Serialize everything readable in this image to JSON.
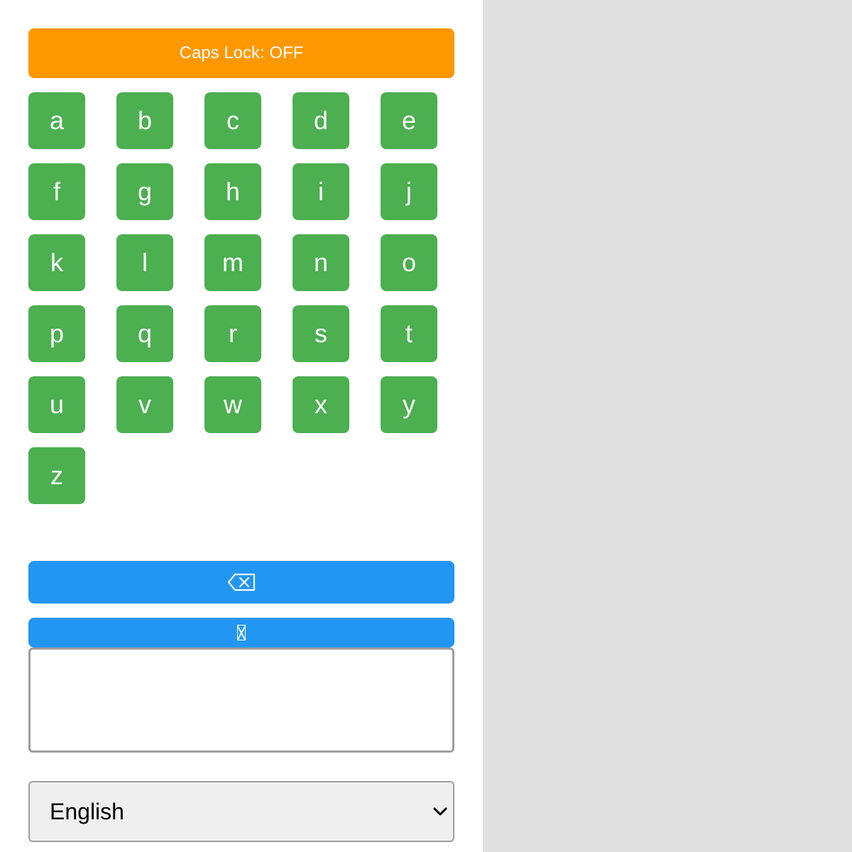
{
  "colors": {
    "caps_button": "#ff9800",
    "key": "#4caf50",
    "action_button": "#2196f3",
    "side_panel": "#e0e0e0"
  },
  "caps_lock": {
    "label": "Caps Lock: OFF"
  },
  "keys": [
    "a",
    "b",
    "c",
    "d",
    "e",
    "f",
    "g",
    "h",
    "i",
    "j",
    "k",
    "l",
    "m",
    "n",
    "o",
    "p",
    "q",
    "r",
    "s",
    "t",
    "u",
    "v",
    "w",
    "x",
    "y",
    "z"
  ],
  "backspace": {
    "label": "⌫",
    "icon": "backspace-icon"
  },
  "enter": {
    "icon": "missing-glyph-icon"
  },
  "text_output": {
    "value": ""
  },
  "language": {
    "selected": "English",
    "icon": "chevron-down-icon"
  }
}
